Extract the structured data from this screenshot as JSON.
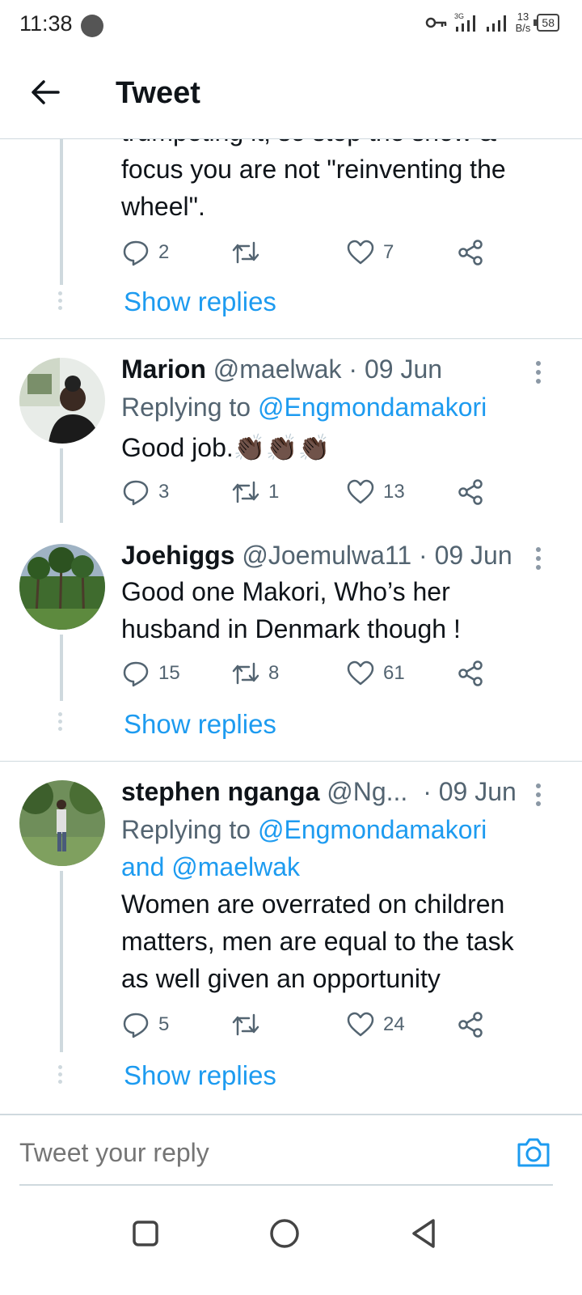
{
  "status_bar": {
    "time": "11:38",
    "network": "3G",
    "net_speed_value": "13",
    "net_speed_unit": "B/s",
    "battery": "58"
  },
  "header": {
    "title": "Tweet"
  },
  "partial_tweet": {
    "text_line1": "trumpeting it, so stop the show &",
    "text_line2": "focus you are not \"reinventing the",
    "text_line3": "wheel\".",
    "replies": "2",
    "retweets": "",
    "likes": "7",
    "show_replies": "Show replies"
  },
  "tweets": [
    {
      "name": "Marion",
      "handle": "@maelwak",
      "date": "· 09 Jun",
      "replying_prefix": "Replying to",
      "replying_to": "@Engmondamakori",
      "text": "Good job.👏🏿👏🏿👏🏿",
      "replies": "3",
      "retweets": "1",
      "likes": "13"
    },
    {
      "name": "Joehiggs",
      "handle": "@Joemulwa11",
      "date": "· 09 Jun",
      "text_line1": "Good one Makori,  Who’s her",
      "text_line2": "husband in Denmark though !",
      "replies": "15",
      "retweets": "8",
      "likes": "61",
      "show_replies": "Show replies"
    },
    {
      "name": "stephen nganga",
      "handle": "@Ng...",
      "date": "· 09 Jun",
      "replying_prefix": "Replying to",
      "replying_to": "@Engmondamakori",
      "replying_and": "and",
      "replying_to_2": "@maelwak",
      "text_line1": "Women are overrated on children",
      "text_line2": "matters, men are equal to the task",
      "text_line3": "as well given an opportunity",
      "replies": "5",
      "retweets": "",
      "likes": "24",
      "show_replies": "Show replies"
    }
  ],
  "composer": {
    "placeholder": "Tweet your reply"
  },
  "colors": {
    "accent": "#1d9bf0",
    "muted": "#536471",
    "divider": "#cfd9de"
  }
}
